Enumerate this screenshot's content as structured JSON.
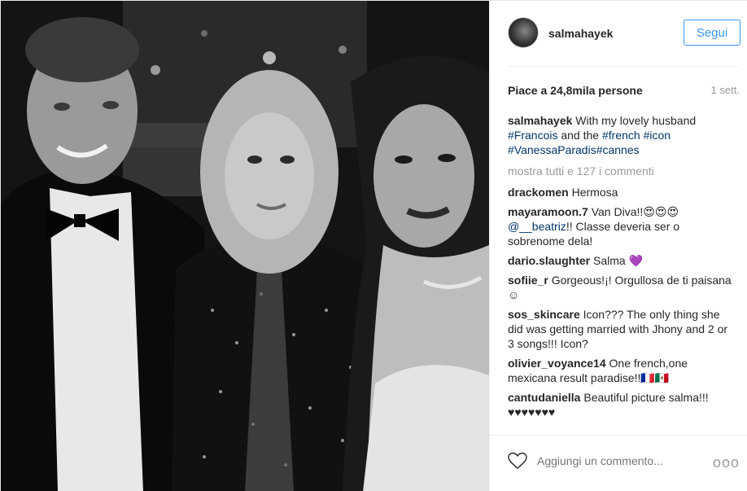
{
  "post": {
    "username": "salmahayek",
    "follow_label": "Segui",
    "likes": "Piace a 24,8mila persone",
    "time": "1 sett.",
    "caption": {
      "user": "salmahayek",
      "text_1": "With my lovely husband",
      "tags": [
        "#Francois",
        "and the",
        "#french",
        "#icon",
        "#VanessaParadis",
        "#cannes"
      ]
    },
    "load_more": "mostra tutti e 127 i commenti",
    "comments": [
      {
        "user": "drackomen",
        "text": "Hermosa"
      },
      {
        "user": "mayaramoon.7",
        "text": "Van Diva!!😍😍😍",
        "mention": "@__beatriz",
        "text_2": "!! Classe deveria ser o sobrenome dela!"
      },
      {
        "user": "dario.slaughter",
        "text": "Salma 💜"
      },
      {
        "user": "sofiie_r",
        "text": "Gorgeous!¡! Orgullosa de ti paisana☺"
      },
      {
        "user": "sos_skincare",
        "text": "Icon??? The only thing she did was getting married with Jhony and 2 or 3 songs!!! Icon?"
      },
      {
        "user": "olivier_voyance14",
        "text": "One french,one mexicana result paradise!!🇫🇷🇲🇽"
      },
      {
        "user": "cantudaniella",
        "text": "Beautiful picture salma!!! ♥♥♥♥♥♥♥"
      }
    ],
    "comment_placeholder": "Aggiungi un commento...",
    "more_label": "ooo"
  },
  "photo": {
    "description_icon": "photo-bw-three-people"
  },
  "colors": {
    "follow_blue": "#3897f0",
    "hashtag": "#003569",
    "muted": "#999999"
  }
}
